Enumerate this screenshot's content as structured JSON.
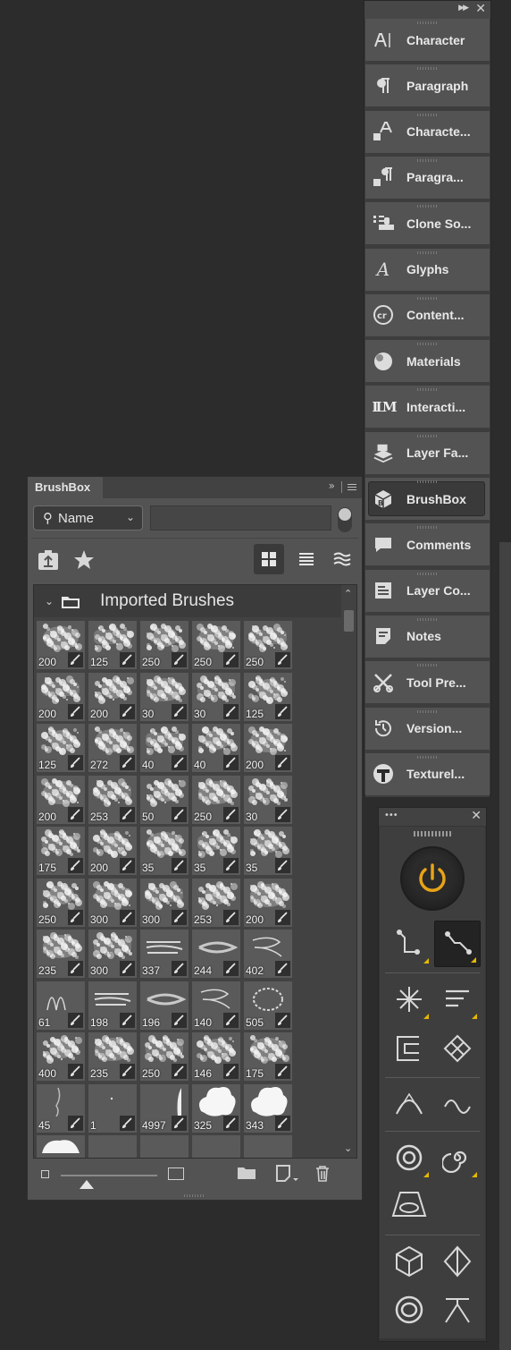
{
  "dock": {
    "items": [
      {
        "label": "Character",
        "icon": "character-icon"
      },
      {
        "label": "Paragraph",
        "icon": "paragraph-icon"
      },
      {
        "label": "Characte...",
        "icon": "character-styles-icon"
      },
      {
        "label": "Paragra...",
        "icon": "paragraph-styles-icon"
      },
      {
        "label": "Clone So...",
        "icon": "clone-source-icon"
      },
      {
        "label": "Glyphs",
        "icon": "glyphs-icon"
      },
      {
        "label": "Content...",
        "icon": "content-credentials-icon"
      },
      {
        "label": "Materials",
        "icon": "materials-icon"
      },
      {
        "label": "Interacti...",
        "icon": "interactive-icon"
      },
      {
        "label": "Layer Fa...",
        "icon": "layer-factory-icon"
      },
      {
        "label": "BrushBox",
        "icon": "brushbox-icon",
        "active": true
      },
      {
        "label": "Comments",
        "icon": "comments-icon"
      },
      {
        "label": "Layer Co...",
        "icon": "layer-comps-icon"
      },
      {
        "label": "Notes",
        "icon": "notes-icon"
      },
      {
        "label": "Tool Pre...",
        "icon": "tool-presets-icon"
      },
      {
        "label": "Version...",
        "icon": "version-history-icon"
      },
      {
        "label": "Texturel...",
        "icon": "texturelabs-icon"
      }
    ]
  },
  "brushbox": {
    "tab_label": "BrushBox",
    "search_mode": "Name",
    "search_value": "",
    "folder_name": "Imported Brushes",
    "brushes": [
      [
        "200",
        "125",
        "250",
        "250",
        "250"
      ],
      [
        "200",
        "200",
        "30",
        "30",
        "125"
      ],
      [
        "125",
        "272",
        "40",
        "40",
        "200"
      ],
      [
        "200",
        "253",
        "50",
        "250",
        "30"
      ],
      [
        "175",
        "200",
        "35",
        "35",
        "35"
      ],
      [
        "250",
        "300",
        "300",
        "253",
        "200"
      ],
      [
        "235",
        "300",
        "337",
        "244",
        "402"
      ],
      [
        "61",
        "198",
        "196",
        "140",
        "505"
      ],
      [
        "400",
        "235",
        "250",
        "146",
        "175"
      ],
      [
        "45",
        "1",
        "4997",
        "325",
        "343"
      ]
    ]
  },
  "colors": {
    "accent": "#e8a317",
    "panel": "#535353",
    "background": "#2c2c2c"
  }
}
